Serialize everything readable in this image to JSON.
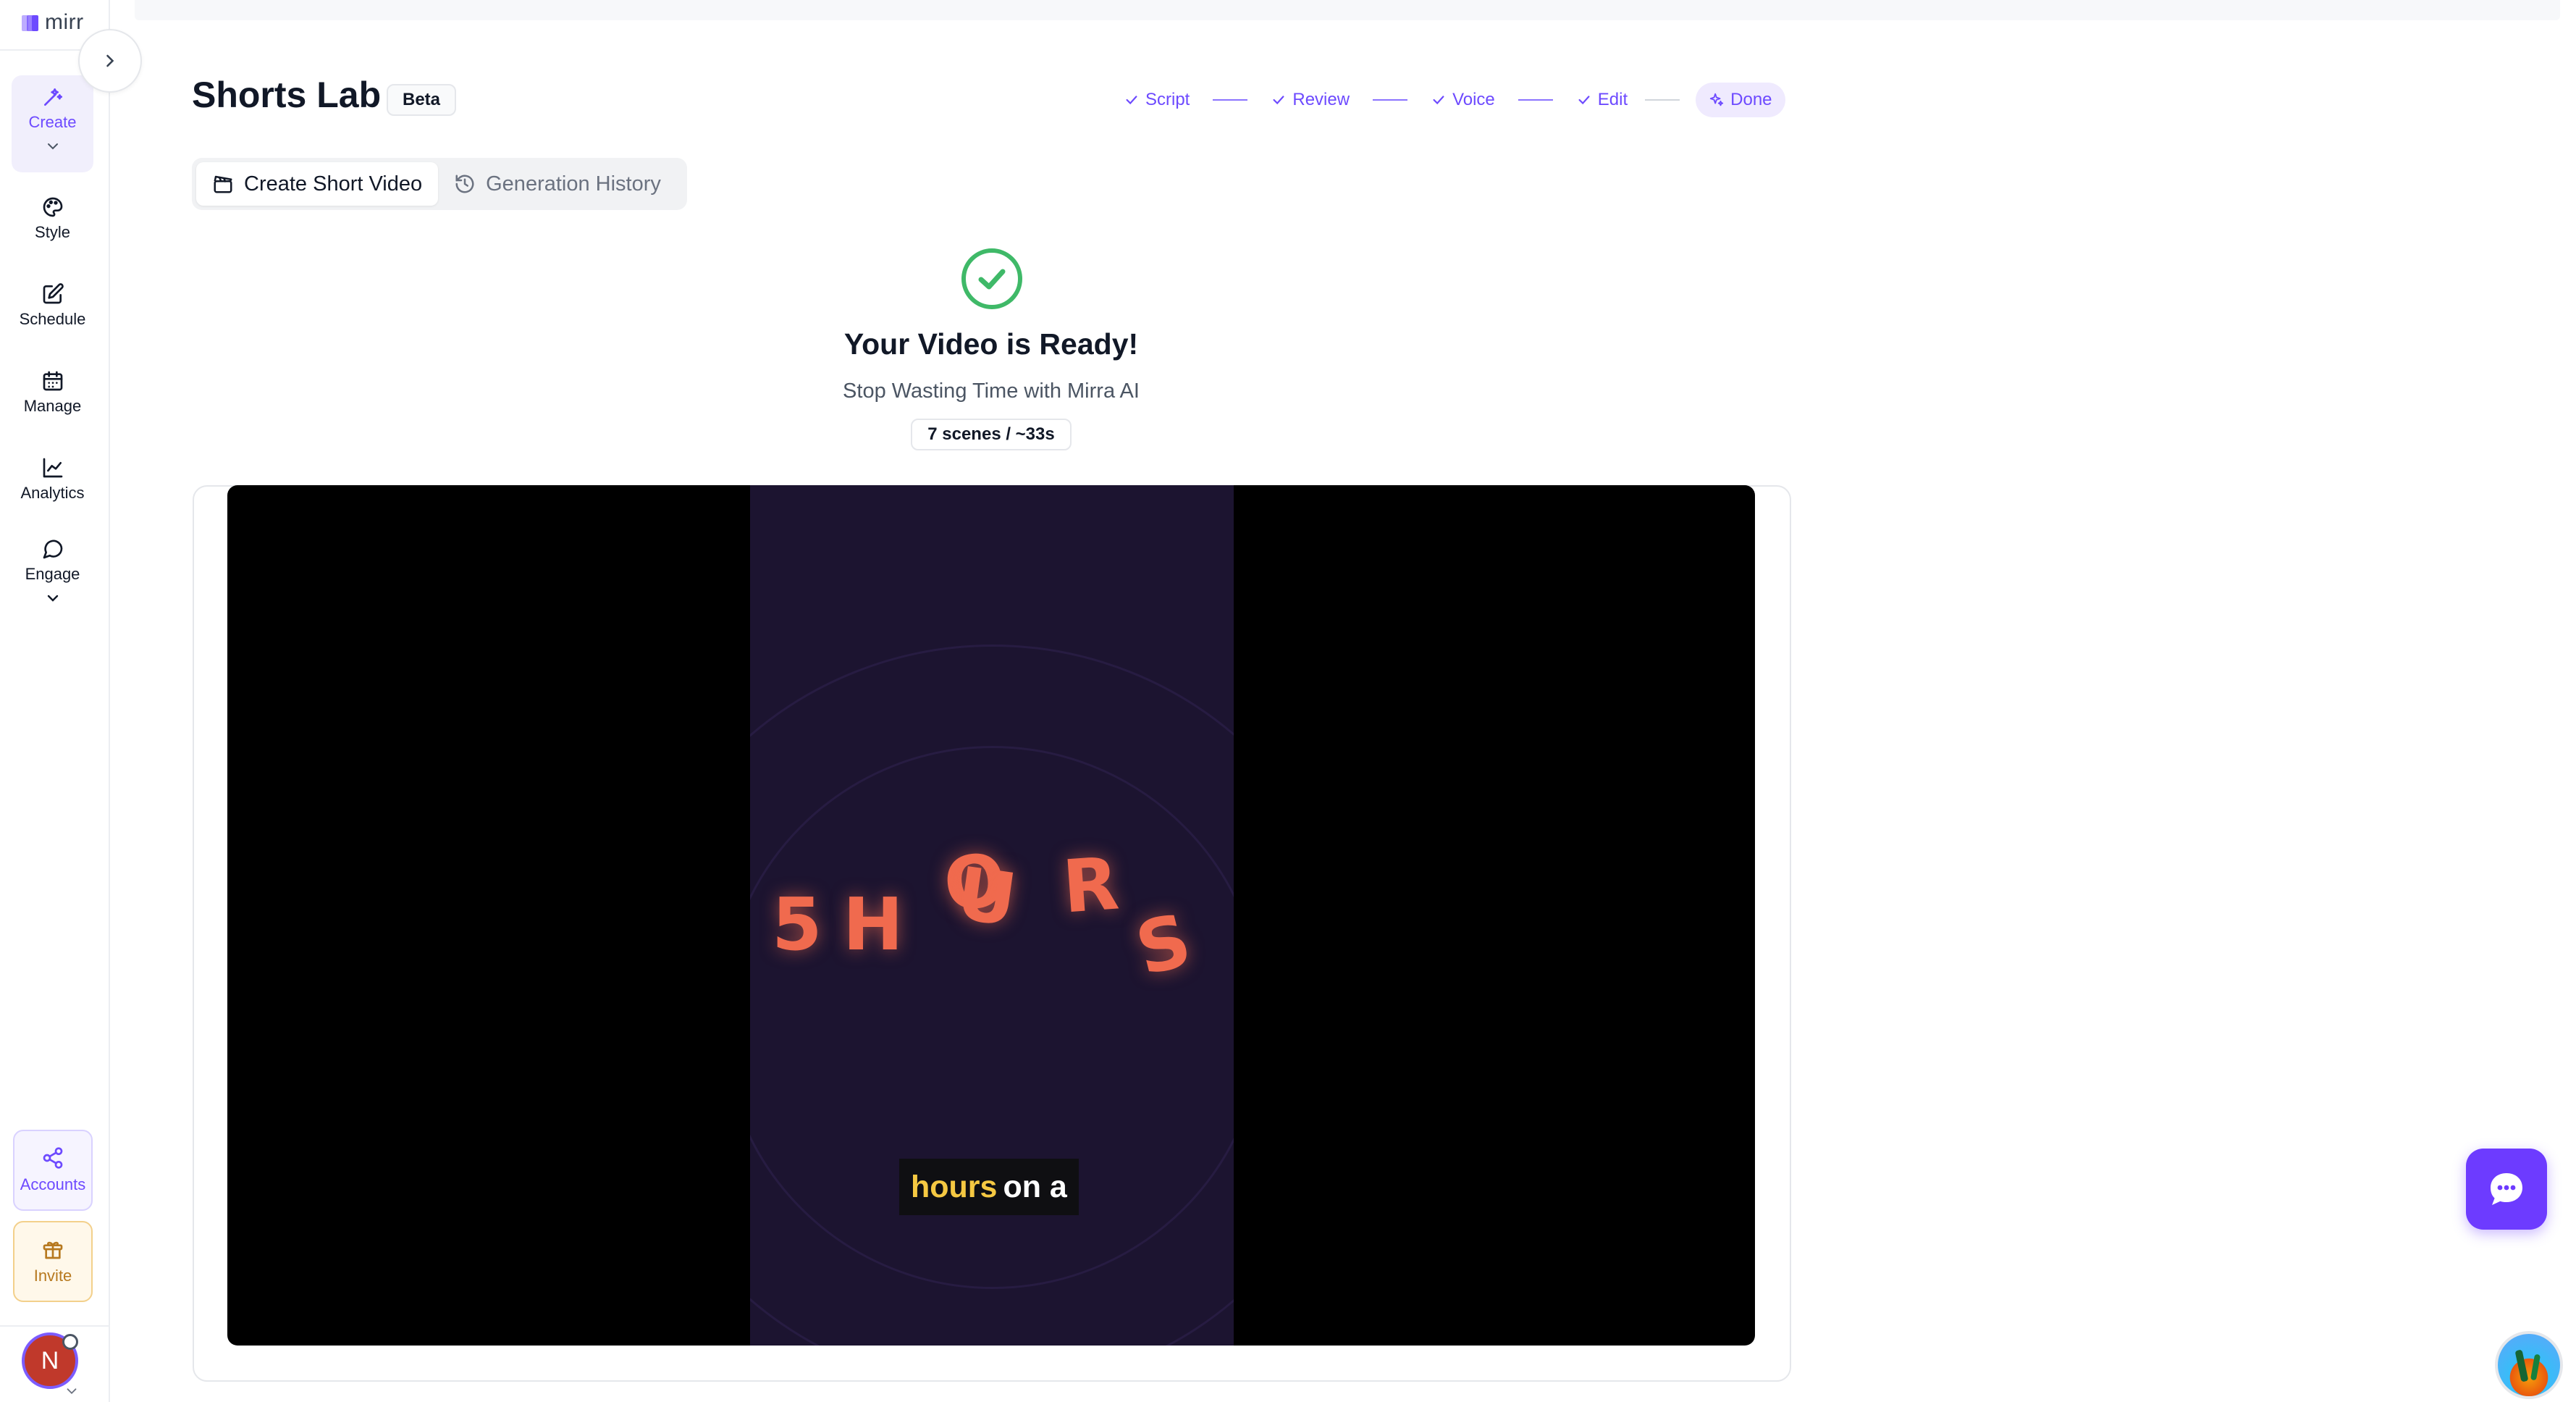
{
  "app": {
    "logo_text": "mirr",
    "brand_color": "#6d4aff"
  },
  "sidebar": {
    "items": [
      {
        "label": "Create",
        "icon": "magic-wand-icon"
      },
      {
        "label": "Style",
        "icon": "palette-icon"
      },
      {
        "label": "Schedule",
        "icon": "edit-square-icon"
      },
      {
        "label": "Manage",
        "icon": "calendar-icon"
      },
      {
        "label": "Analytics",
        "icon": "line-chart-icon"
      },
      {
        "label": "Engage",
        "icon": "message-circle-icon"
      }
    ],
    "accounts_label": "Accounts",
    "invite_label": "Invite",
    "avatar_initial": "N"
  },
  "header": {
    "title": "Shorts Lab",
    "badge": "Beta",
    "steps": [
      {
        "label": "Script",
        "done": true
      },
      {
        "label": "Review",
        "done": true
      },
      {
        "label": "Voice",
        "done": true
      },
      {
        "label": "Edit",
        "done": true
      },
      {
        "label": "Done",
        "active": true
      }
    ]
  },
  "tabs": [
    {
      "label": "Create Short Video",
      "selected": true
    },
    {
      "label": "Generation History",
      "selected": false
    }
  ],
  "result": {
    "title": "Your Video is Ready!",
    "subtitle": "Stop Wasting Time with Mirra AI",
    "scenes_badge": "7 scenes / ~33s",
    "success_color": "#3fb968"
  },
  "video": {
    "letters": [
      "5",
      "H",
      "O",
      "U",
      "R",
      "S"
    ],
    "caption_highlight": "hours",
    "caption_rest": "on a"
  }
}
